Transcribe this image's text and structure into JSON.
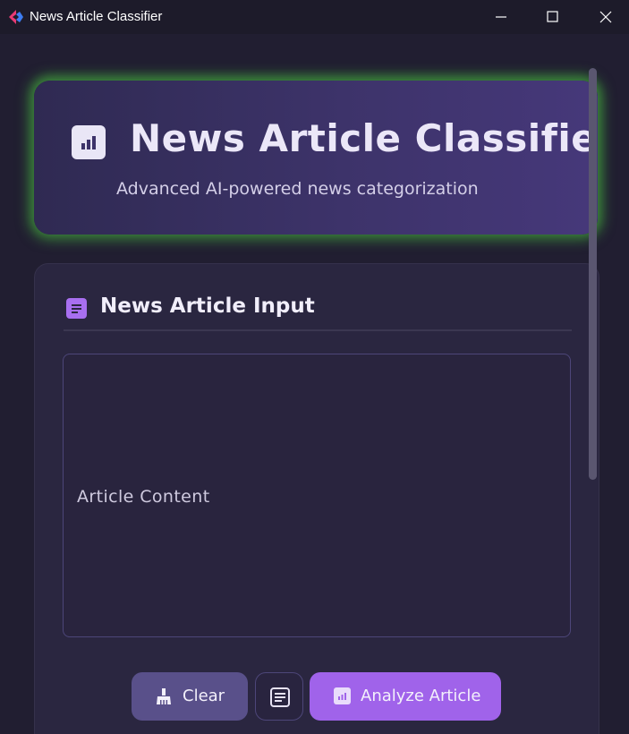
{
  "window": {
    "title": "News Article Classifier",
    "controls": [
      "minimize-icon",
      "maximize-icon",
      "close-icon"
    ]
  },
  "header": {
    "icon": "bar-chart-icon",
    "title": "News Article Classifier",
    "subtitle": "Advanced AI-powered news categorization"
  },
  "input_section": {
    "icon": "document-icon",
    "title": "News Article Input",
    "textarea_label": "Article Content",
    "textarea_value": ""
  },
  "buttons": {
    "clear_label": "Clear",
    "clear_icon": "broom-icon",
    "sample_icon": "article-icon",
    "analyze_label": "Analyze Article",
    "analyze_icon": "bar-chart-icon"
  },
  "colors": {
    "accent": "#a063ea",
    "header_glow": "#48be40",
    "background": "#211e31"
  }
}
